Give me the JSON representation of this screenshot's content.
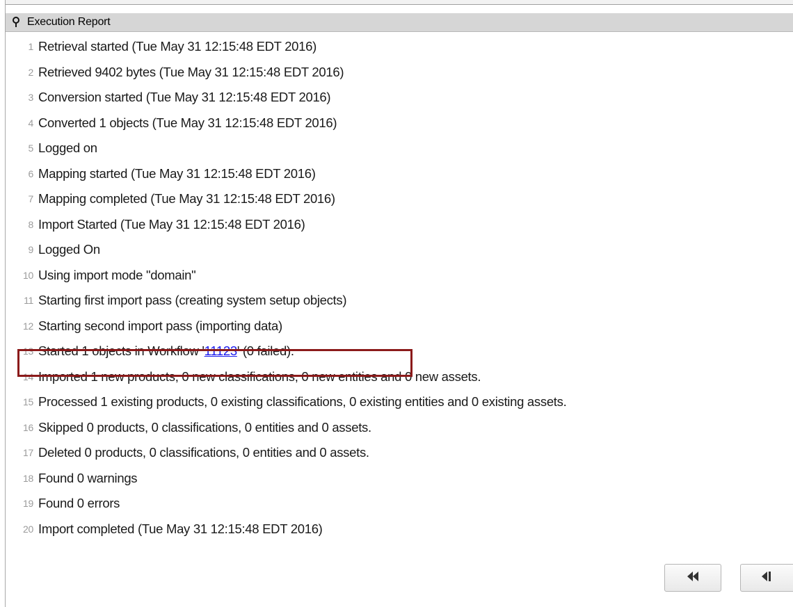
{
  "panel": {
    "title": "Execution Report",
    "pin_icon": "pin-icon"
  },
  "log": {
    "lines": [
      {
        "num": "1",
        "text": "Retrieval started (Tue May 31 12:15:48 EDT 2016)"
      },
      {
        "num": "2",
        "text": "Retrieved 9402 bytes (Tue May 31 12:15:48 EDT 2016)"
      },
      {
        "num": "3",
        "text": "Conversion started (Tue May 31 12:15:48 EDT 2016)"
      },
      {
        "num": "4",
        "text": "Converted 1 objects (Tue May 31 12:15:48 EDT 2016)"
      },
      {
        "num": "5",
        "text": "Logged on"
      },
      {
        "num": "6",
        "text": "Mapping started (Tue May 31 12:15:48 EDT 2016)"
      },
      {
        "num": "7",
        "text": "Mapping completed (Tue May 31 12:15:48 EDT 2016)"
      },
      {
        "num": "8",
        "text": "Import Started (Tue May 31 12:15:48 EDT 2016)"
      },
      {
        "num": "9",
        "text": "Logged On"
      },
      {
        "num": "10",
        "text": "Using import mode \"domain\""
      },
      {
        "num": "11",
        "text": "Starting first import pass (creating system setup objects)"
      },
      {
        "num": "12",
        "text": "Starting second import pass (importing data)"
      },
      {
        "num": "13",
        "prefix": "Started 1 objects in Workflow '",
        "link": "11123",
        "suffix": "' (0 failed)."
      },
      {
        "num": "14",
        "text": "Imported 1 new products, 0 new classifications, 0 new entities and 0 new assets."
      },
      {
        "num": "15",
        "text": "Processed 1 existing products, 0 existing classifications, 0 existing entities and 0 existing assets."
      },
      {
        "num": "16",
        "text": "Skipped 0 products, 0 classifications, 0 entities and 0 assets."
      },
      {
        "num": "17",
        "text": "Deleted 0 products, 0 classifications, 0 entities and 0 assets."
      },
      {
        "num": "18",
        "text": "Found 0 warnings"
      },
      {
        "num": "19",
        "text": "Found 0 errors"
      },
      {
        "num": "20",
        "text": "Import completed (Tue May 31 12:15:48 EDT 2016)"
      }
    ]
  },
  "nav": {
    "first_icon": "rewind-first-icon",
    "prev_icon": "step-back-icon"
  },
  "colors": {
    "title_bar": "#d6d6d6",
    "highlight_border": "#8b1a1a",
    "link": "#1a1aee",
    "line_number": "#9b9b9b"
  }
}
